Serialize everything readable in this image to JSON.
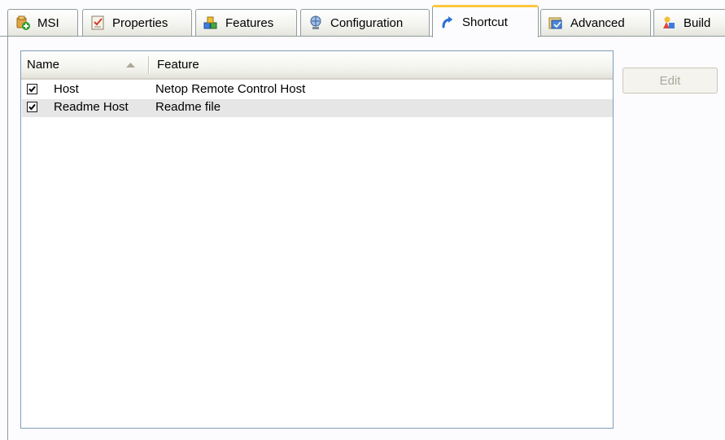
{
  "tabs": [
    {
      "label": "MSI",
      "icon": "msi-package-icon"
    },
    {
      "label": "Properties",
      "icon": "properties-icon"
    },
    {
      "label": "Features",
      "icon": "features-icon"
    },
    {
      "label": "Configuration",
      "icon": "configuration-icon"
    },
    {
      "label": "Shortcut",
      "icon": "shortcut-arrow-icon"
    },
    {
      "label": "Advanced",
      "icon": "advanced-icon"
    },
    {
      "label": "Build",
      "icon": "build-icon"
    }
  ],
  "active_tab": "Shortcut",
  "list": {
    "columns": [
      "Name",
      "Feature"
    ],
    "sort_column": "Name",
    "sort_direction": "ascending",
    "rows": [
      {
        "checked": true,
        "name": "Host",
        "feature": "Netop Remote Control Host"
      },
      {
        "checked": true,
        "name": "Readme Host",
        "feature": "Readme file"
      }
    ],
    "selected_row": 1
  },
  "buttons": {
    "edit_label": "Edit",
    "edit_enabled": false
  },
  "colors": {
    "active_tab_accent": "#ffc83c",
    "tab_border": "#919b9c",
    "list_border": "#7f9db9",
    "disabled_text": "#aca899",
    "selected_row": "#e6e6e6"
  }
}
